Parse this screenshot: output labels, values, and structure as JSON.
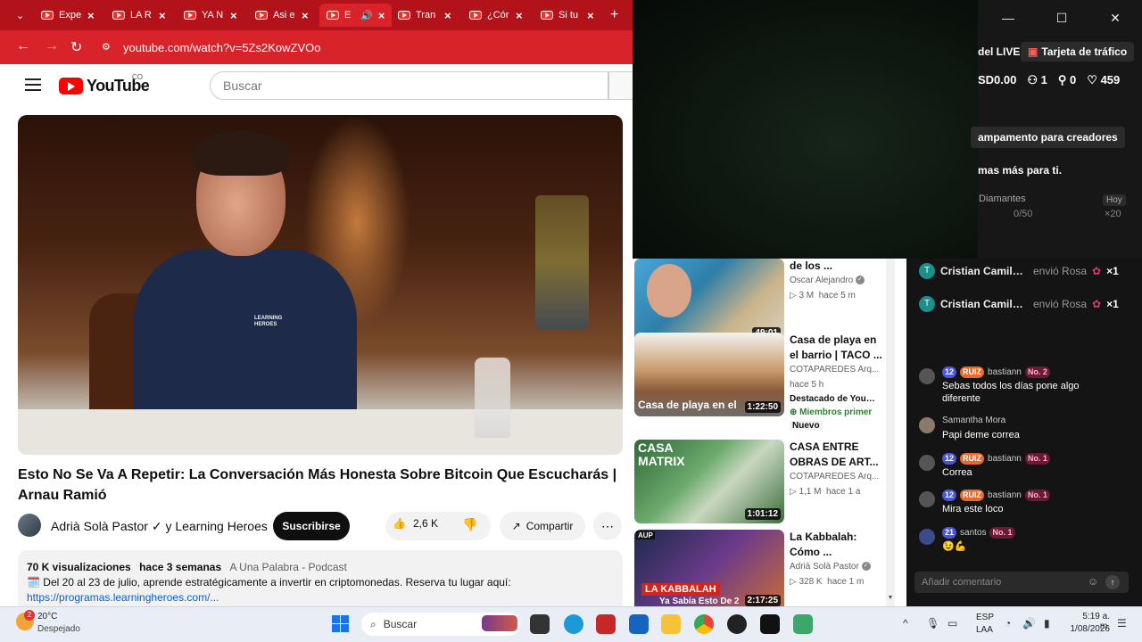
{
  "browser": {
    "tabs": [
      {
        "title": "Expe"
      },
      {
        "title": "LA R"
      },
      {
        "title": "YA N"
      },
      {
        "title": "Asi e"
      },
      {
        "title": "E"
      },
      {
        "title": "Tran"
      },
      {
        "title": "¿Cór"
      },
      {
        "title": "Si tu"
      }
    ],
    "url": "youtube.com/watch?v=5Zs2KowZVOo"
  },
  "youtube": {
    "logo_text": "YouTube",
    "country": "CO",
    "search_placeholder": "Buscar",
    "video": {
      "title": "Esto No Se Va A Repetir: La Conversación Más Honesta Sobre Bitcoin Que Escucharás | Arnau Ramió",
      "channel": "Adrià Solà Pastor ✓ y Learning Heroes",
      "subscribe_label": "Suscribirse",
      "likes": "2,6 K",
      "share_label": "Compartir",
      "shirt_text": "LEARNING HEROES",
      "views": "70 K visualizaciones",
      "age": "hace 3 semanas",
      "podcast": "A Una Palabra - Podcast",
      "desc_line": "🗓️ Del 20 al 23 de julio, aprende estratégicamente a invertir en criptomonedas. Reserva tu lugar aquí:",
      "desc_link": "https://programas.learningheroes.com/..."
    },
    "recommendations": [
      {
        "title": "de los ...",
        "channel": "Oscar Alejandro",
        "views": "▷ 3 M",
        "age": "hace 5 m",
        "duration": "49:01"
      },
      {
        "title": "Casa de playa en el barrio | TACO ...",
        "channel": "COTAPAREDES Arq...",
        "age": "hace 5 h",
        "extra1": "Destacado de YouTul",
        "extra2": "Miembros primer",
        "extra3": "Nuevo",
        "duration": "1:22:50",
        "thumb_text": "Casa de playa en el"
      },
      {
        "title": "CASA ENTRE OBRAS DE ART...",
        "channel": "COTAPAREDES Arq...",
        "views": "▷ 1,1 M",
        "age": "hace 1 a",
        "duration": "1:01:12",
        "thumb_text": "CASA MATRIX"
      },
      {
        "title": "La Kabbalah: Cómo ...",
        "channel": "Adrià Solà Pastor",
        "views": "▷ 328 K",
        "age": "hace 1 m",
        "duration": "2:17:25",
        "thumb_text": "LA KABBALAH",
        "thumb_text2": "Ya Sabía Esto De 2",
        "thumb_badge": "AUP"
      }
    ]
  },
  "live_panel": {
    "live_label": "del LIVE",
    "traffic_card": "Tarjeta de tráfico",
    "stats": [
      "SD0.00",
      "1",
      "0",
      "459"
    ],
    "camp": "ampamento para creadores",
    "temas": "mas más para ti.",
    "diamantes": "Diamantes",
    "hoy": "Hoy",
    "progress": "0/50",
    "mult": "×20"
  },
  "chat": {
    "gifts": [
      {
        "initial": "T",
        "user": "Cristian Camilo 2...",
        "action": "envió Rosa",
        "count": "×1"
      },
      {
        "initial": "T",
        "user": "Cristian Camilo 2...",
        "action": "envió Rosa",
        "count": "×1"
      }
    ],
    "messages": [
      {
        "lvl": "12",
        "club": "RUIZ",
        "user": "bastiann",
        "rank": "No. 2",
        "text": "Sebas todos los días pone algo diferente"
      },
      {
        "user": "Samantha Mora",
        "text": "Papi deme correa"
      },
      {
        "lvl": "12",
        "club": "RUIZ",
        "user": "bastiann",
        "rank": "No. 1",
        "text": "Correa"
      },
      {
        "lvl": "12",
        "club": "RUIZ",
        "user": "bastiann",
        "rank": "No. 1",
        "text": "Mira este loco"
      },
      {
        "lvl": "21",
        "user": "santos",
        "rank": "No. 1",
        "text": "😉💪"
      }
    ],
    "comment_placeholder": "Añadir comentario"
  },
  "taskbar": {
    "temp": "20°C",
    "weather": "Despejado",
    "weather_badge": "2",
    "search": "Buscar",
    "lang1": "ESP",
    "lang2": "LAA",
    "time": "5:19 a. m.",
    "date": "1/08/2026"
  }
}
